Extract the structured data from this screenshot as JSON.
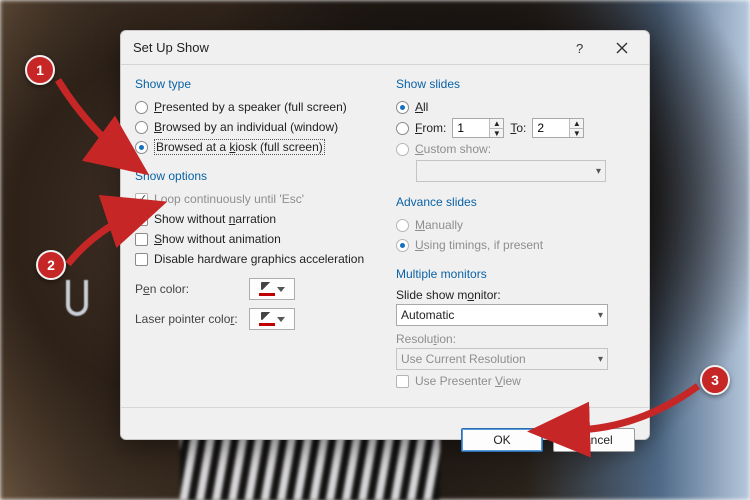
{
  "dialog_title": "Set Up Show",
  "groups": {
    "show_type": "Show type",
    "show_options": "Show options",
    "show_slides": "Show slides",
    "advance": "Advance slides",
    "monitors": "Multiple monitors"
  },
  "show_type": {
    "presented": "Presented by a speaker (full screen)",
    "browsed_ind": "Browsed by an individual (window)",
    "kiosk": "Browsed at a kiosk (full screen)"
  },
  "show_options": {
    "loop": "Loop continuously until 'Esc'",
    "no_narration": "Show without narration",
    "no_animation": "Show without animation",
    "disable_hw": "Disable hardware graphics acceleration",
    "pen_label": "Pen color:",
    "laser_label": "Laser pointer color:"
  },
  "show_slides": {
    "all": "All",
    "from": "From:",
    "to": "To:",
    "from_val": "1",
    "to_val": "2",
    "custom": "Custom show:",
    "custom_val": ""
  },
  "advance": {
    "manual": "Manually",
    "timings": "Using timings, if present"
  },
  "monitors": {
    "monitor_label": "Slide show monitor:",
    "monitor_val": "Automatic",
    "res_label": "Resolution:",
    "res_val": "Use Current Resolution",
    "presenter": "Use Presenter View"
  },
  "buttons": {
    "ok": "OK",
    "cancel": "Cancel"
  },
  "callouts": {
    "c1": "1",
    "c2": "2",
    "c3": "3"
  }
}
